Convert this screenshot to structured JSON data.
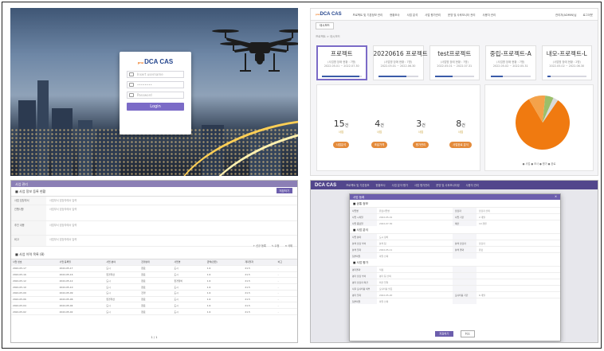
{
  "login": {
    "brand_prefix": "pnu",
    "brand": "DCA CAS",
    "username_placeholder": "Insert username",
    "password_placeholder": "••••••••",
    "extra_placeholder": "Password",
    "login_button": "Login"
  },
  "dashboard": {
    "logo_prefix": "pnu",
    "logo": "DCA CAS",
    "nav": [
      "프로젝트 및 기본정보 관리",
      "현황조사",
      "사업 분석",
      "사업 평가관리",
      "운영 및 사후모니터 관리",
      "사용자 관리"
    ],
    "nav_right": [
      "관리자(ADMIN)님",
      "로그아웃"
    ],
    "breadcrumb": "프로젝트 > 대시보드",
    "tab": "대시보드",
    "projects": [
      {
        "title": "프로젝트",
        "sub": "(사업명 장애 현황 : 7명)",
        "dates": "2022.05.01 ~ 2022.07.30",
        "progress": 0.95
      },
      {
        "title": "20220616 프로젝트",
        "sub": "(사업명 장애 현황 : 7명)",
        "dates": "2022.05.01 ~ 2022.06.30",
        "progress": 0.7
      },
      {
        "title": "test프로젝트",
        "sub": "(사업명 장애 현황 : 7명)",
        "dates": "2022.05.01 ~ 2022.07.31",
        "progress": 0.45
      },
      {
        "title": "중립-프로젝트-A",
        "sub": "(사업명 장애 현황 : 7명)",
        "dates": "2022.05.02 ~ 2022.05.31",
        "progress": 0.3
      },
      {
        "title": "내모-프로젝트-L",
        "sub": "(사업명 장애 현황 : 2명)",
        "dates": "2022.05.02 ~ 2022.06.30",
        "progress": 0.1
      }
    ],
    "stats": [
      {
        "value": "15",
        "unit": "건",
        "label": "사업",
        "button": "사업분석"
      },
      {
        "value": "4",
        "unit": "건",
        "label": "사업",
        "button": "조달가격"
      },
      {
        "value": "3",
        "unit": "건",
        "label": "사업",
        "button": "평가관리"
      },
      {
        "value": "8",
        "unit": "건",
        "label": "사업",
        "button": "사업완료 분석"
      }
    ],
    "pie_legend": "● 사업 ● 조사 ● 평가 ● 완료",
    "accent": "#7b6bc7",
    "pie_colors": [
      "#f07a10",
      "#f4a24a",
      "#9bbf6a",
      "#d9d9d9"
    ]
  },
  "chart_data": {
    "type": "pie",
    "categories": [
      "사업",
      "조사",
      "평가",
      "완료"
    ],
    "values": [
      82,
      10,
      5,
      3
    ]
  },
  "list_page": {
    "header": "사업 관리",
    "section1": "■ 사업 정보 등록 현황",
    "save_button": "저장하기",
    "fields": [
      {
        "key": "사업 담당부서",
        "value": "사업부서 담당자에서 입력"
      },
      {
        "key": "진행사항",
        "value": "사업부서 담당자에서 입력"
      },
      {
        "key": "추진 내용",
        "value": "사업부서 담당자에서 입력"
      },
      {
        "key": "비고",
        "value": "사업부서 담당자에서 입력"
      }
    ],
    "section2": "■ 사업 이력 목록 (8)",
    "tools": [
      "+ 신규 등록",
      "✎ 수정",
      "✕ 삭제"
    ],
    "columns": [
      "사업 번호",
      "사업 등록일",
      "사업 분야",
      "진행상태",
      "사업명",
      "금액(천원)",
      "계획일자",
      "비고"
    ],
    "rows": [
      [
        "2022-05-17",
        "2022-05-17",
        "도시",
        "완료",
        "도시",
        "1.6",
        "21.5",
        "-"
      ],
      [
        "2022-05-16",
        "2022-05-16",
        "환경개선",
        "완료",
        "도시",
        "1.6",
        "21.5",
        "-"
      ],
      [
        "2022-05-12",
        "2022-05-12",
        "도시",
        "완료",
        "환경정비",
        "1.6",
        "21.5",
        "-"
      ],
      [
        "2022-05-10",
        "2022-05-10",
        "도시",
        "완료",
        "도시",
        "1.6",
        "21.5",
        "-"
      ],
      [
        "2022-05-09",
        "2022-05-09",
        "도시",
        "진행",
        "도시",
        "1.6",
        "21.5",
        "-"
      ],
      [
        "2022-05-06",
        "2022-05-06",
        "환경개선",
        "완료",
        "도시",
        "1.6",
        "21.5",
        "-"
      ],
      [
        "2022-05-04",
        "2022-05-04",
        "도시",
        "완료",
        "도시",
        "1.6",
        "21.5",
        "-"
      ],
      [
        "2022-05-02",
        "2022-05-02",
        "도시",
        "완료",
        "도시",
        "1.6",
        "21.5",
        "-"
      ]
    ],
    "pager": "1 / 1"
  },
  "modal_page": {
    "logo": "DCA CAS",
    "nav": [
      "프로젝트 및 기본정보",
      "현황조사",
      "사업 분석·평가",
      "사업 평가관리",
      "운영 및 사후모니터링",
      "사용자 관리"
    ],
    "title": "사업 등록",
    "close": "✕",
    "section1": "■ 공통 정보",
    "rows1": [
      [
        "사업명",
        "완료사업명",
        "담당자",
        "담당자 선택"
      ],
      [
        "사업 시작일",
        "2022-05-01",
        "사업 기간",
        "2 개월"
      ],
      [
        "사업 종료일",
        "2022-07-30",
        "예산",
        "10 천원"
      ]
    ],
    "section2": "■ 사업 분석",
    "rows2": [
      [
        "사업 분야",
        "도시 정비",
        "",
        ""
      ],
      [
        "분석 담당 부서",
        "분석 팀",
        "분석 담당자",
        "담당자"
      ],
      [
        "분석 일자",
        "2022-05-11",
        "분석 결과",
        "완료"
      ],
      [
        "첨부파일",
        "파일 선택",
        "",
        ""
      ]
    ],
    "section3": "■ 사업 평가",
    "rows3": [
      [
        "평가결과",
        "적정",
        "",
        ""
      ],
      [
        "평가 담당 부서",
        "평가 팀 선택",
        "",
        ""
      ],
      [
        "평가 담당자 의견",
        "의견 입력",
        "",
        ""
      ],
      [
        "사후 모니터링 여부",
        "모니터링 필요",
        "",
        ""
      ],
      [
        "평가 일자",
        "2022-05-20",
        "모니터링 기간",
        "6 개월"
      ],
      [
        "첨부파일",
        "파일 선택",
        "",
        ""
      ]
    ],
    "save": "저장하기",
    "cancel": "취소"
  }
}
